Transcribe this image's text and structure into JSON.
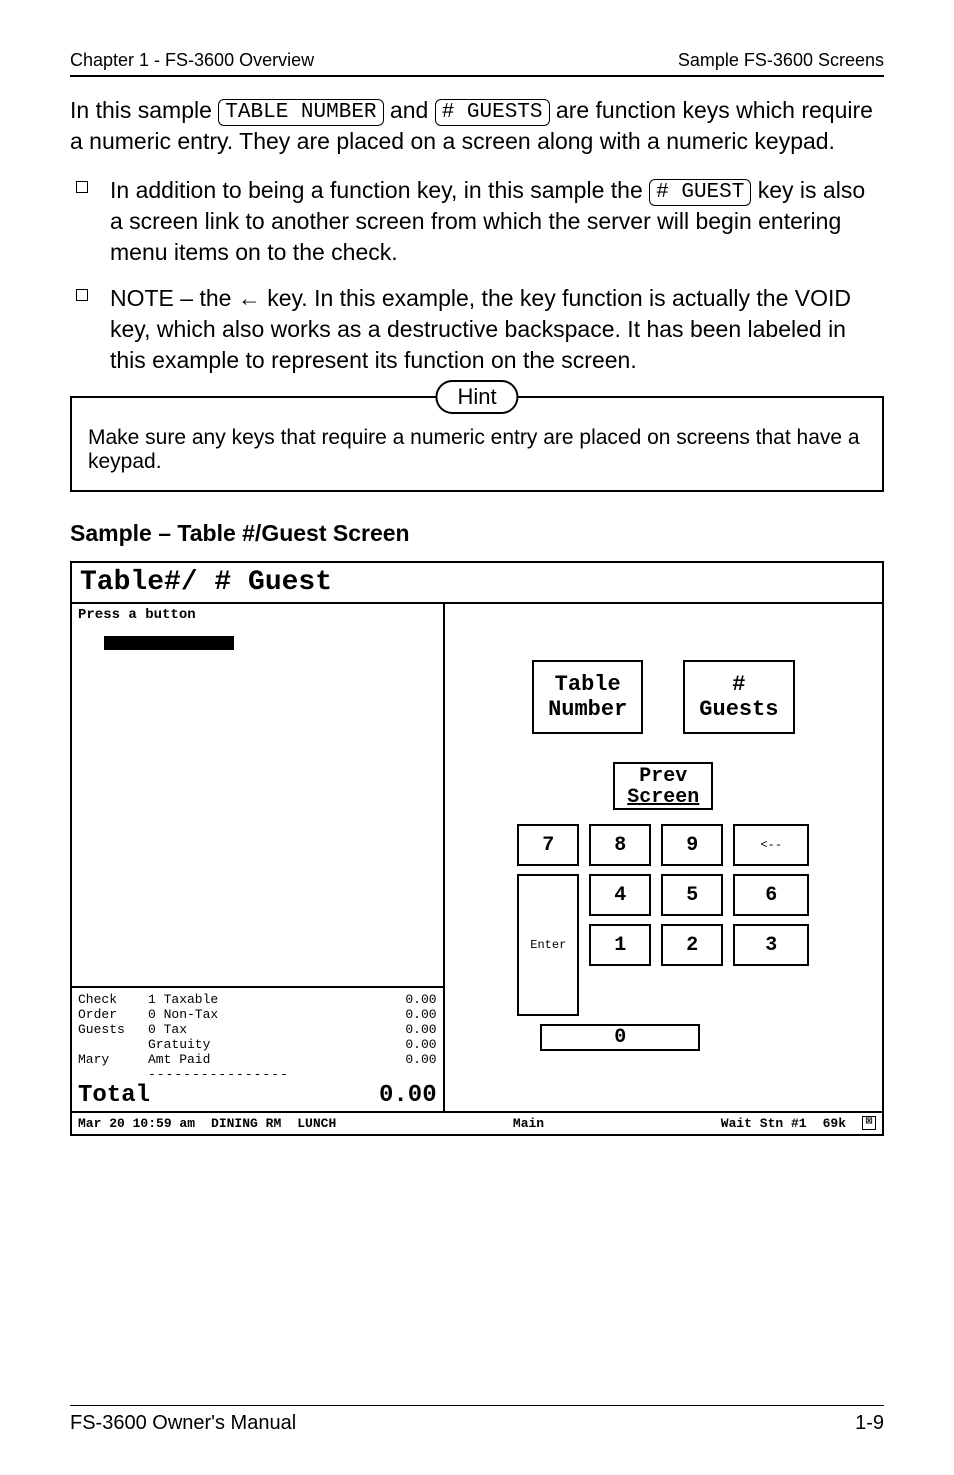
{
  "header": {
    "left": "Chapter 1 - FS-3600 Overview",
    "right": "Sample FS-3600 Screens"
  },
  "intro": {
    "prefix": "In this sample ",
    "key1": "TABLE NUMBER",
    "mid1": " and ",
    "key2": "# GUESTS",
    "suffix": " are function keys which require a numeric entry.  They are placed on a screen along with a numeric keypad."
  },
  "bullets": {
    "b1_pre": "In addition to being a function key, in this sample the ",
    "b1_key": "# GUEST",
    "b1_post": " key is also a screen link to another screen from which the server will begin entering menu items on to the check.",
    "b2": "NOTE – the ← key.  In this example, the key function is actually the VOID key, which also works as a destructive backspace.  It has been labeled in this example to represent its function on the screen."
  },
  "hint": {
    "label": "Hint",
    "text": "Make sure any keys that require a numeric entry are placed on screens that have a keypad."
  },
  "section_heading": "Sample – Table #/Guest Screen",
  "screen": {
    "title": "Table#/ # Guest",
    "prompt": "Press a button",
    "totals": {
      "rows": [
        {
          "c1": "Check",
          "c2": "1 Taxable",
          "c3": "0.00"
        },
        {
          "c1": "Order",
          "c2": "0 Non-Tax",
          "c3": "0.00"
        },
        {
          "c1": "Guests",
          "c2": "0 Tax",
          "c3": "0.00"
        },
        {
          "c1": "",
          "c2": "  Gratuity",
          "c3": "0.00"
        },
        {
          "c1": "Mary",
          "c2": "  Amt Paid",
          "c3": "0.00"
        }
      ],
      "dashes": "  ----------------",
      "total_label": "Total",
      "total_value": "0.00"
    },
    "keys": {
      "table_l1": "Table",
      "table_l2": "Number",
      "guests_l1": "#",
      "guests_l2": "Guests",
      "prev_l1": "Prev",
      "prev_l2": "Screen",
      "n7": "7",
      "n8": "8",
      "n9": "9",
      "back": "<--",
      "n4": "4",
      "n5": "5",
      "n6": "6",
      "enter": "Enter",
      "n1": "1",
      "n2": "2",
      "n3": "3",
      "n0": "0"
    },
    "status": {
      "datetime": "Mar 20 10:59 am",
      "area": "DINING RM",
      "meal": "LUNCH",
      "main": "Main",
      "station": "Wait Stn #1",
      "mem": "69k",
      "x": "⊠"
    }
  },
  "footer": {
    "left": "FS-3600 Owner's Manual",
    "right": "1-9"
  }
}
